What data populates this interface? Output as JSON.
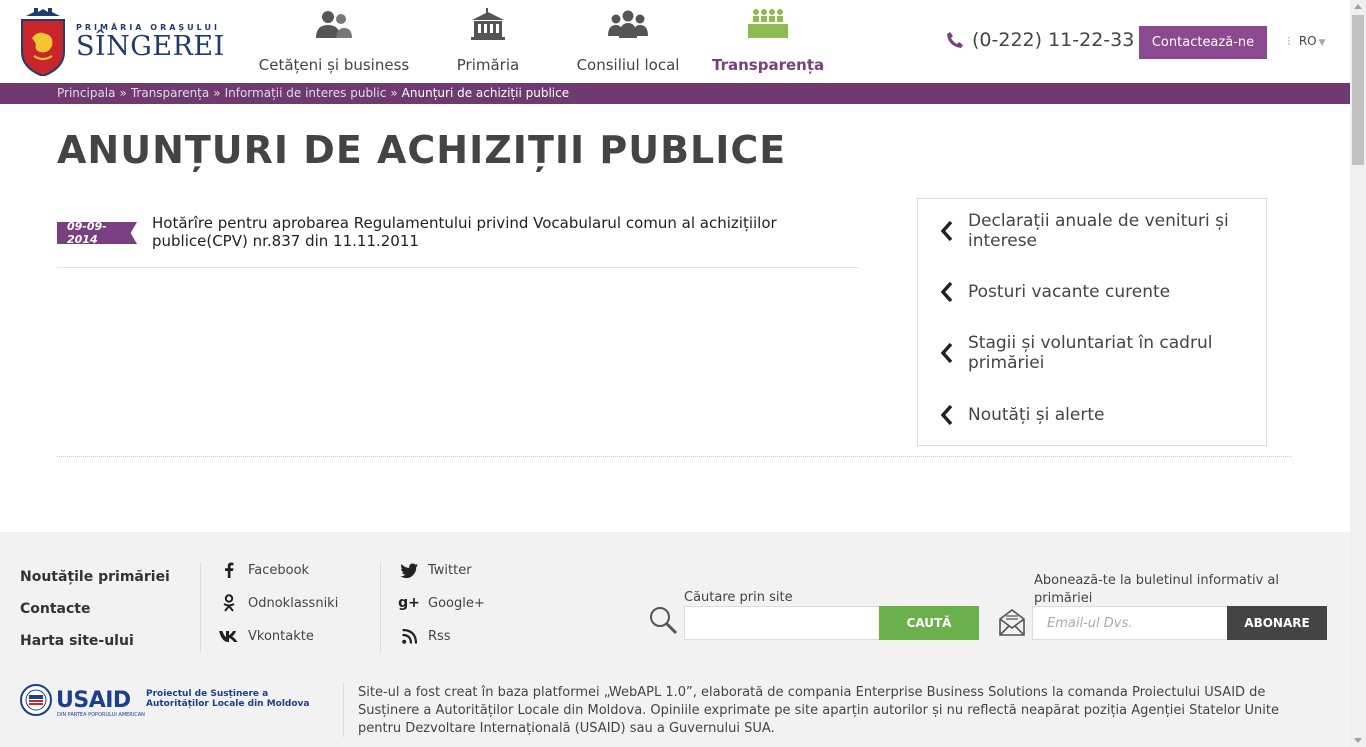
{
  "header": {
    "logo_small": "PRIMĂRIA ORAȘULUI",
    "logo_big": "SÎNGEREI",
    "nav": [
      {
        "label": "Cetățeni și business",
        "icon": "people-icon"
      },
      {
        "label": "Primăria",
        "icon": "building-icon"
      },
      {
        "label": "Consiliul local",
        "icon": "council-icon"
      },
      {
        "label": "Transparența",
        "icon": "meeting-icon",
        "active": true
      }
    ],
    "phone": "(0-222) 11-22-33",
    "contact_label": "Contactează-ne",
    "lang": "RO"
  },
  "breadcrumb": {
    "items": [
      "Principala",
      "Transparența",
      "Informații de interes public"
    ],
    "current": "Anunțuri de achiziții publice"
  },
  "page": {
    "title": "ANUNȚURI DE ACHIZIȚII PUBLICE"
  },
  "articles": [
    {
      "date": "09-09-2014",
      "title": "Hotărîre pentru aprobarea Regulamentului privind Vocabularul comun al achizițiilor publice(CPV) nr.837 din 11.11.2011"
    }
  ],
  "sidebar": {
    "items": [
      "Declarații anuale de venituri și interese",
      "Posturi vacante curente",
      "Stagii și voluntariat în cadrul primăriei",
      "Noutăți și alerte"
    ]
  },
  "footer": {
    "links": [
      "Noutățile primăriei",
      "Contacte",
      "Harta site-ului"
    ],
    "social_col1": [
      {
        "label": "Facebook",
        "icon": "facebook-icon"
      },
      {
        "label": "Odnoklassniki",
        "icon": "odnoklassniki-icon"
      },
      {
        "label": "Vkontakte",
        "icon": "vkontakte-icon"
      }
    ],
    "social_col2": [
      {
        "label": "Twitter",
        "icon": "twitter-icon"
      },
      {
        "label": "Google+",
        "icon": "googleplus-icon"
      },
      {
        "label": "Rss",
        "icon": "rss-icon"
      }
    ],
    "search_label": "Căutare prin site",
    "search_button": "CAUTĂ",
    "subscribe_label": "Abonează-te la buletinul informativ al primăriei",
    "subscribe_placeholder": "Email-ul Dvs.",
    "subscribe_button": "ABONARE",
    "usaid_word": "USAID",
    "usaid_sub": "DIN PARTEA POPORULUI AMERICAN",
    "usaid_project": "Proiectul de Susținere a Autorităților Locale din Moldova",
    "note": "Site-ul a fost creat în baza platformei „WebAPL 1.0”, elaborată de compania Enterprise Business Solutions la comanda Proiectului USAID de Susținere a Autorităților Locale din Moldova. Opiniile exprimate pe site aparțin autorilor și nu reflectă neapărat poziția Agenției Statelor Unite pentru Dezvoltare Internațională (USAID) sau a Guvernului SUA."
  },
  "colors": {
    "accent": "#7a3f80",
    "bar": "#6f3a6f",
    "search_button": "#6ab04c",
    "logo_blue": "#1f3b70"
  }
}
